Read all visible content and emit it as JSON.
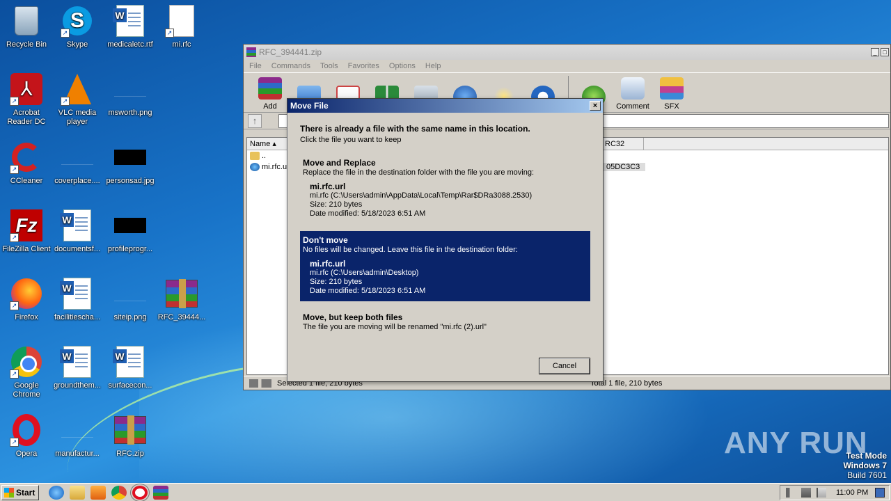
{
  "desktop": {
    "icons": [
      {
        "label": "Recycle Bin",
        "icon": "recycle-bin-icon"
      },
      {
        "label": "Skype",
        "icon": "skype-icon"
      },
      {
        "label": "medicaletc.rtf",
        "icon": "word-document-icon"
      },
      {
        "label": "mi.rfc",
        "icon": "blank-file-icon"
      },
      {
        "label": "Acrobat Reader DC",
        "icon": "acrobat-icon"
      },
      {
        "label": "VLC media player",
        "icon": "vlc-icon"
      },
      {
        "label": "msworth.png",
        "icon": "image-file-icon"
      },
      {
        "label": "CCleaner",
        "icon": "ccleaner-icon"
      },
      {
        "label": "coverplace....",
        "icon": "image-file-icon"
      },
      {
        "label": "personsad.jpg",
        "icon": "image-file-icon"
      },
      {
        "label": "FileZilla Client",
        "icon": "filezilla-icon"
      },
      {
        "label": "documentsf...",
        "icon": "word-document-icon"
      },
      {
        "label": "profileprogr...",
        "icon": "image-file-icon"
      },
      {
        "label": "Firefox",
        "icon": "firefox-icon"
      },
      {
        "label": "facilitiescha...",
        "icon": "word-document-icon"
      },
      {
        "label": "siteip.png",
        "icon": "image-file-icon"
      },
      {
        "label": "RFC_39444...",
        "icon": "winrar-archive-icon"
      },
      {
        "label": "Google Chrome",
        "icon": "chrome-icon"
      },
      {
        "label": "groundthem...",
        "icon": "word-document-icon"
      },
      {
        "label": "surfacecon...",
        "icon": "word-document-icon"
      },
      {
        "label": "Opera",
        "icon": "opera-icon"
      },
      {
        "label": "manufactur...",
        "icon": "image-file-icon"
      },
      {
        "label": "RFC.zip",
        "icon": "winrar-archive-icon"
      }
    ]
  },
  "winrar": {
    "title": "RFC_394441.zip",
    "menu": [
      "File",
      "Commands",
      "Tools",
      "Favorites",
      "Options",
      "Help"
    ],
    "toolbar": {
      "add": "Add",
      "comment": "Comment",
      "sfx": "SFX"
    },
    "list": {
      "col_name": "Name",
      "col_crc": "RC32",
      "rows": [
        {
          "name": "..",
          "crc": ""
        },
        {
          "name": "mi.rfc.u",
          "crc": "05DC3C3"
        }
      ]
    },
    "status": {
      "left": "Selected 1 file, 210 bytes",
      "right": "Total 1 file, 210 bytes"
    }
  },
  "dialog": {
    "title": "Move File",
    "close_glyph": "×",
    "headline": "There is already a file with the same name in this location.",
    "subline": "Click the file you want to keep",
    "replace": {
      "title": "Move and Replace",
      "desc": "Replace the file in the destination folder with the file you are moving:",
      "file_name": "mi.rfc.url",
      "file_path": "mi.rfc (C:\\Users\\admin\\AppData\\Local\\Temp\\Rar$DRa3088.2530)",
      "size": "Size: 210 bytes",
      "date": "Date modified: 5/18/2023 6:51 AM"
    },
    "dont_move": {
      "title": "Don't move",
      "desc": "No files will be changed. Leave this file in the destination folder:",
      "file_name": "mi.rfc.url",
      "file_path": "mi.rfc (C:\\Users\\admin\\Desktop)",
      "size": "Size: 210 bytes",
      "date": "Date modified: 5/18/2023 6:51 AM"
    },
    "keep_both": {
      "title": "Move, but keep both files",
      "desc": "The file you are moving will be renamed \"mi.rfc (2).url\""
    },
    "cancel_label": "Cancel"
  },
  "taskbar": {
    "start_label": "Start",
    "clock": "11:00 PM"
  },
  "watermark": "ANY RUN",
  "test_mode": {
    "line1": "Test Mode",
    "line2": "Windows 7",
    "line3": "Build 7601"
  }
}
